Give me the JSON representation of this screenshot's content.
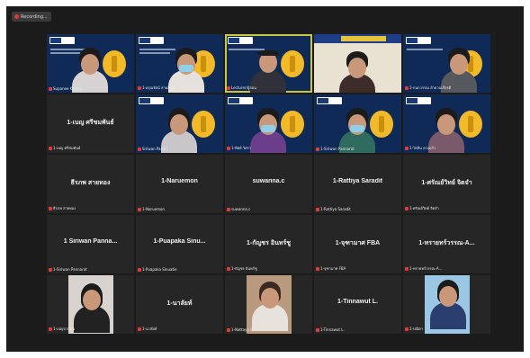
{
  "window": {
    "recording_label": "Recording...",
    "accent": "#c9c640",
    "slide_bg": "#0f2a56"
  },
  "tiles": [
    {
      "kind": "video",
      "caption": "Supanee Kumsu..."
    },
    {
      "kind": "video",
      "caption": "1-อรุณรัตน์ สายสวลี"
    },
    {
      "kind": "video",
      "caption": "Lecturer/ผู้สอน",
      "active": true
    },
    {
      "kind": "video",
      "caption": ""
    },
    {
      "kind": "video",
      "caption": "1-กนกวรรณ ลำดวนเกียรติ"
    },
    {
      "kind": "name",
      "name": "1-เบญ ศรีชมพันธ์",
      "caption": "1-เบญ ศรีชมพันธ์"
    },
    {
      "kind": "video",
      "caption": "Siriwan Pansri"
    },
    {
      "kind": "video",
      "caption": "1-ทิพย์ วิศรา"
    },
    {
      "kind": "video",
      "caption": "1-Siriwan Pannarat"
    },
    {
      "kind": "video",
      "caption": "1-ไพลิน ดวงแก้ว"
    },
    {
      "kind": "name",
      "name": "ธีรภพ สายทอง",
      "caption": "ธีรภพ สายทอง"
    },
    {
      "kind": "name",
      "name": "1-Naruemon",
      "caption": "1-Naruemon"
    },
    {
      "kind": "name",
      "name": "suwanna.c",
      "caption": "suwanna.c"
    },
    {
      "kind": "name",
      "name": "1-Rattiya Saradit",
      "caption": "1-Rattiya Saradit"
    },
    {
      "kind": "name",
      "name": "1-ศรัณย์วิทย์ จิตจำ",
      "caption": "1-ศรัณย์วิทย์ จิตจำ"
    },
    {
      "kind": "name",
      "name": "1 Siriwan Panna...",
      "caption": "1-Siriwan Pannarat"
    },
    {
      "kind": "name",
      "name": "1-Puapaka Sinu...",
      "caption": "1-Puapaka Sinuatie"
    },
    {
      "kind": "name",
      "name": "1-กัญชร อินทร์ชู",
      "caption": "1-กัญชร อินทร์ชู"
    },
    {
      "kind": "name",
      "name": "1-จุฑามาศ FBA",
      "caption": "1-จุฑามาศ FBA"
    },
    {
      "kind": "name",
      "name": "1-ทรายทร์วรรณ-A...",
      "caption": "1-ทรายทร์วรรณ-A..."
    },
    {
      "kind": "photo",
      "caption": "1-เบญจวรรณ"
    },
    {
      "kind": "name",
      "name": "1-นาลัยท์",
      "caption": "1-นาลัยท์"
    },
    {
      "kind": "photo",
      "caption": "1-Nattaya S."
    },
    {
      "kind": "name",
      "name": "1-Tinnawut L.",
      "caption": "1-Tinnawut L."
    },
    {
      "kind": "photo",
      "caption": "1-ปณิตา"
    }
  ]
}
